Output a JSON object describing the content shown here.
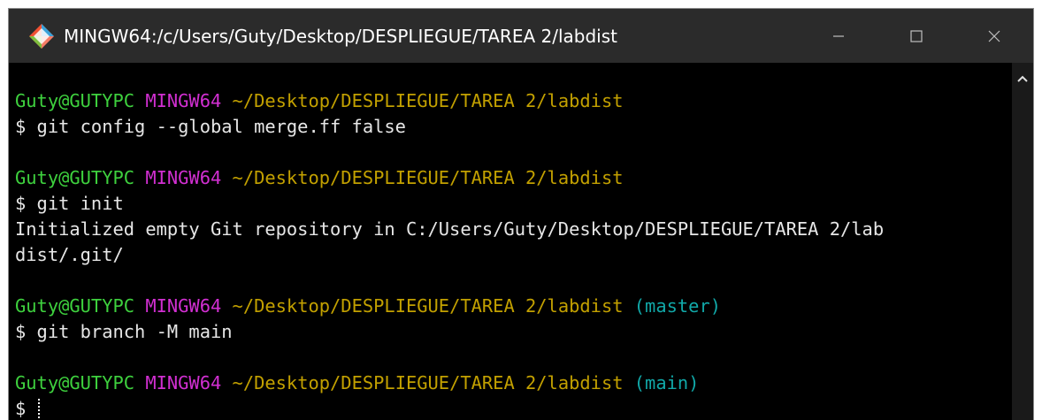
{
  "window": {
    "title": "MINGW64:/c/Users/Guty/Desktop/DESPLIEGUE/TAREA 2/labdist",
    "controls": {
      "minimize_icon": "minimize-icon",
      "maximize_icon": "maximize-icon",
      "close_icon": "close-icon"
    }
  },
  "colors": {
    "user": "#3ed13e",
    "system": "#d22fd2",
    "path": "#c2a000",
    "branch": "#11a8a8",
    "background": "#000000"
  },
  "terminal": {
    "blocks": [
      {
        "user": "Guty@GUTYPC",
        "system": "MINGW64",
        "path": "~/Desktop/DESPLIEGUE/TAREA 2/labdist",
        "branch": "",
        "command": "$ git config --global merge.ff false",
        "output": []
      },
      {
        "user": "Guty@GUTYPC",
        "system": "MINGW64",
        "path": "~/Desktop/DESPLIEGUE/TAREA 2/labdist",
        "branch": "",
        "command": "$ git init",
        "output": [
          "Initialized empty Git repository in C:/Users/Guty/Desktop/DESPLIEGUE/TAREA 2/lab",
          "dist/.git/"
        ]
      },
      {
        "user": "Guty@GUTYPC",
        "system": "MINGW64",
        "path": "~/Desktop/DESPLIEGUE/TAREA 2/labdist",
        "branch": "(master)",
        "command": "$ git branch -M main",
        "output": []
      },
      {
        "user": "Guty@GUTYPC",
        "system": "MINGW64",
        "path": "~/Desktop/DESPLIEGUE/TAREA 2/labdist",
        "branch": "(main)",
        "command": "$ ",
        "output": []
      }
    ]
  }
}
